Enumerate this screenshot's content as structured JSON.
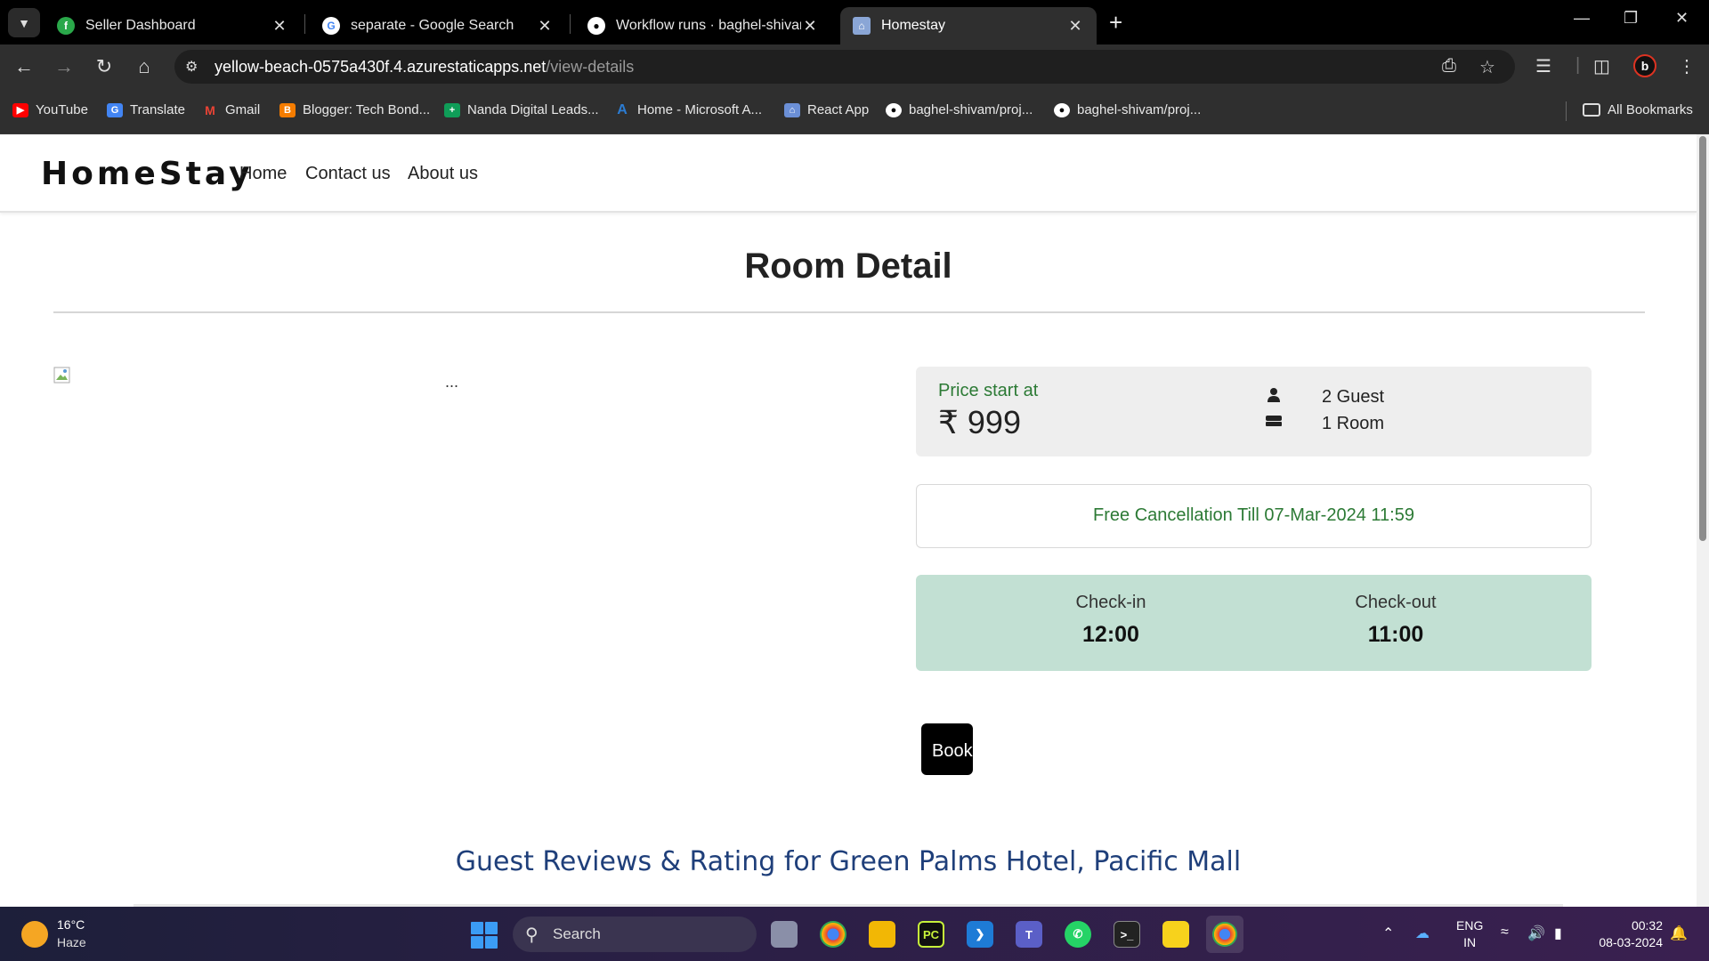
{
  "browser": {
    "tabs": [
      {
        "title": "Seller Dashboard",
        "favicon": "flipkart-icon"
      },
      {
        "title": "separate - Google Search",
        "favicon": "google-icon"
      },
      {
        "title": "Workflow runs · baghel-shivam/",
        "favicon": "github-icon"
      },
      {
        "title": "Homestay",
        "favicon": "homestay-icon",
        "active": true
      }
    ],
    "url_host": "yellow-beach-0575a430f.4.azurestaticapps.net",
    "url_path": "/view-details",
    "bookmarks": [
      {
        "label": "YouTube",
        "icon": "youtube-icon",
        "color": "#ff0000"
      },
      {
        "label": "Translate",
        "icon": "translate-icon",
        "color": "#4285f4"
      },
      {
        "label": "Gmail",
        "icon": "gmail-icon",
        "color": "#ea4335"
      },
      {
        "label": "Blogger: Tech Bond...",
        "icon": "blogger-icon",
        "color": "#f57c00"
      },
      {
        "label": "Nanda Digital Leads...",
        "icon": "sheets-icon",
        "color": "#0f9d58"
      },
      {
        "label": "Home - Microsoft A...",
        "icon": "azure-icon",
        "color": "#2b7cd3"
      },
      {
        "label": "React App",
        "icon": "react-app-icon",
        "color": "#6b8fd6"
      },
      {
        "label": "baghel-shivam/proj...",
        "icon": "github-icon",
        "color": "#ffffff"
      },
      {
        "label": "baghel-shivam/proj...",
        "icon": "github-icon",
        "color": "#ffffff"
      }
    ],
    "all_bookmarks": "All Bookmarks"
  },
  "site": {
    "brand": "HomeStay",
    "nav": [
      "Home",
      "Contact us",
      "About us"
    ]
  },
  "room": {
    "title": "Room Detail",
    "image_alt": "...",
    "price_label": "Price start at",
    "price_value": "₹ 999",
    "guests": "2 Guest",
    "rooms": "1 Room",
    "cancellation": "Free Cancellation Till 07-Mar-2024 11:59",
    "checkin_label": "Check-in",
    "checkin_time": "12:00",
    "checkout_label": "Check-out",
    "checkout_time": "11:00",
    "book_label": "Book"
  },
  "reviews": {
    "title": "Guest Reviews & Rating for Green Palms Hotel, Pacific Mall"
  },
  "colors": {
    "accent_green": "#2c7a35",
    "checkin_bg": "#c2e0d3",
    "review_title": "#1f3f7a"
  },
  "taskbar": {
    "temperature": "16°C",
    "condition": "Haze",
    "search": "Search",
    "lang_1": "ENG",
    "lang_2": "IN",
    "time": "00:32",
    "date": "08-03-2024"
  }
}
